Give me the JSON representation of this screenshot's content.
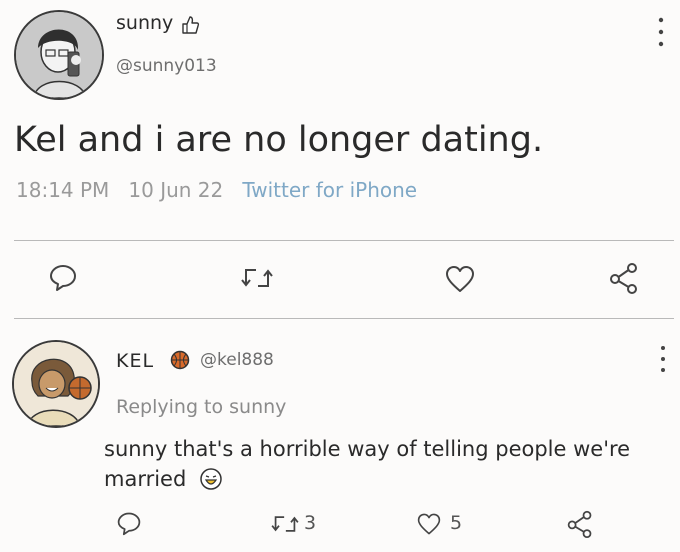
{
  "main_tweet": {
    "author_name": "sunny",
    "author_handle": "@sunny013",
    "text": "Kel and i are no longer dating.",
    "time": "18:14 PM",
    "date": "10 Jun 22",
    "source": "Twitter for iPhone"
  },
  "reply": {
    "author_name": "KEL",
    "author_handle": "@kel888",
    "replying_to": "Replying to sunny",
    "text_line1": "sunny that's a horrible way of telling people we're",
    "text_line2": "married",
    "retweet_count": "3",
    "like_count": "5"
  },
  "icons": {
    "menu": "more-vertical-icon",
    "reply": "reply-icon",
    "retweet": "retweet-icon",
    "like": "heart-icon",
    "share": "share-icon"
  }
}
